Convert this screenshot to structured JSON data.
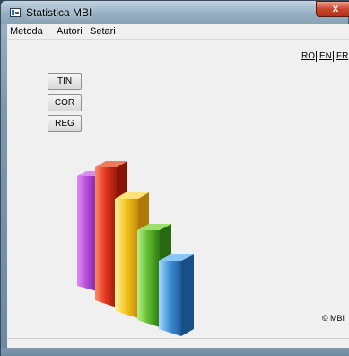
{
  "window": {
    "title": "Statistica MBI",
    "close_label": "x"
  },
  "menu": {
    "items": [
      "Metoda",
      "Autori",
      "Setari"
    ]
  },
  "languages": [
    "RO",
    "EN",
    "FR"
  ],
  "buttons": {
    "tin": "TIN",
    "cor": "COR",
    "reg": "REG"
  },
  "footer": {
    "copyright": "© MBI"
  },
  "logo": {
    "icon": "3d-bar-chart-icon",
    "colors": [
      "#b24bd6",
      "#e0341e",
      "#f2c21a",
      "#5cb82e",
      "#3d8fd6"
    ]
  }
}
